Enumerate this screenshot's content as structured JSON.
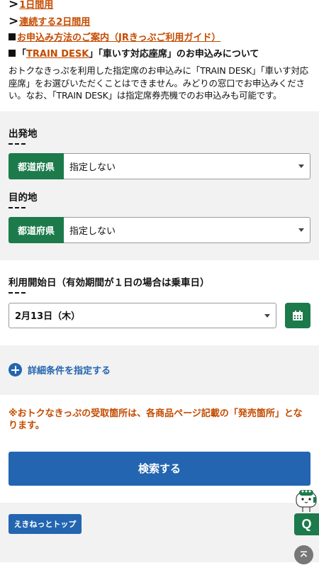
{
  "nav": {
    "one_day": "1日間用",
    "two_day": "連続する2日間用",
    "guide_link": "お申込み方法のご案内（JRきっぷご利用ガイド）",
    "chevron": ">"
  },
  "train_desk": {
    "prefix": "「",
    "link": "TRAIN DESK",
    "suffix": "」「車いす対応座席」のお申込みについて",
    "description": "おトクなきっぷを利用した指定席のお申込みに「TRAIN DESK」「車いす対応座席」をお選びいただくことはできません。みどりの窓口でお申込みください。なお、「TRAIN DESK」は指定席券売機でのお申込みも可能です。"
  },
  "departure": {
    "label": "出発地",
    "badge": "都道府県",
    "value": "指定しない"
  },
  "destination": {
    "label": "目的地",
    "badge": "都道府県",
    "value": "指定しない"
  },
  "start_date": {
    "label": "利用開始日（有効期間が１日の場合は乗車日）",
    "value": "2月13日（木）"
  },
  "detail": {
    "label": "詳細条件を指定する"
  },
  "notice": "※おトクなきっぷの受取箇所は、各商品ページ記載の「発売箇所」となります。",
  "search": {
    "label": "検索する"
  },
  "footer": {
    "top_link": "えきねっとトップ"
  },
  "help": {
    "label": "Q"
  },
  "colors": {
    "green": "#1c7a4b",
    "blue": "#2365b0",
    "orange": "#c44b00",
    "panel": "#f2f2f2"
  }
}
